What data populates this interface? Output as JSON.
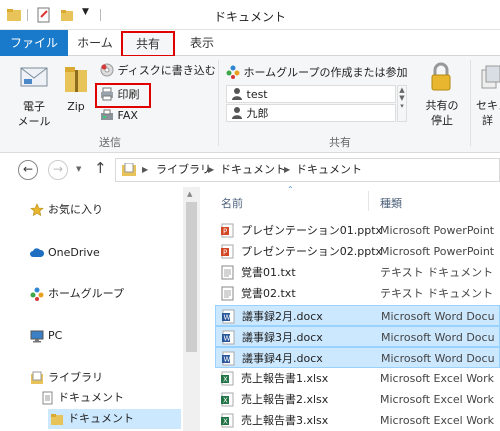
{
  "window": {
    "title": "ドキュメント"
  },
  "tabs": {
    "file": "ファイル",
    "home": "ホーム",
    "share": "共有",
    "view": "表示"
  },
  "ribbon": {
    "email": "電子\nメール",
    "email_l1": "電子",
    "email_l2": "メール",
    "zip": "Zip",
    "burn": "ディスクに書き込む",
    "print": "印刷",
    "fax": "FAX",
    "send_group": "送信",
    "homegroup_create": "ホームグループの作成または参加",
    "share_user1": "test",
    "share_user2": "九郎",
    "share_group": "共有",
    "stop_l1": "共有の",
    "stop_l2": "停止",
    "security_partial": "セキュ",
    "security_partial2": "詳"
  },
  "address": {
    "crumbs": [
      "ライブラリ",
      "ドキュメント",
      "ドキュメント"
    ]
  },
  "navpane": {
    "favorites": "お気に入り",
    "onedrive": "OneDrive",
    "homegroup": "ホームグループ",
    "pc": "PC",
    "libraries": "ライブラリ",
    "documents": "ドキュメント",
    "documents_sub": "ドキュメント"
  },
  "columns": {
    "name": "名前",
    "type": "種類"
  },
  "files": [
    {
      "name": "プレゼンテーション01.pptx",
      "type": "Microsoft PowerPoint",
      "kind": "pptx"
    },
    {
      "name": "プレゼンテーション02.pptx",
      "type": "Microsoft PowerPoint",
      "kind": "pptx"
    },
    {
      "name": "覚書01.txt",
      "type": "テキスト ドキュメント",
      "kind": "txt"
    },
    {
      "name": "覚書02.txt",
      "type": "テキスト ドキュメント",
      "kind": "txt"
    },
    {
      "name": "議事録2月.docx",
      "type": "Microsoft Word Docu",
      "kind": "docx"
    },
    {
      "name": "議事録3月.docx",
      "type": "Microsoft Word Docu",
      "kind": "docx"
    },
    {
      "name": "議事録4月.docx",
      "type": "Microsoft Word Docu",
      "kind": "docx"
    },
    {
      "name": "売上報告書1.xlsx",
      "type": "Microsoft Excel Work",
      "kind": "xlsx"
    },
    {
      "name": "売上報告書2.xlsx",
      "type": "Microsoft Excel Work",
      "kind": "xlsx"
    },
    {
      "name": "売上報告書3.xlsx",
      "type": "Microsoft Excel Work",
      "kind": "xlsx"
    }
  ],
  "colors": {
    "file_tab": "#1979ca",
    "highlight": "#e00000",
    "selection": "#cce8ff"
  }
}
